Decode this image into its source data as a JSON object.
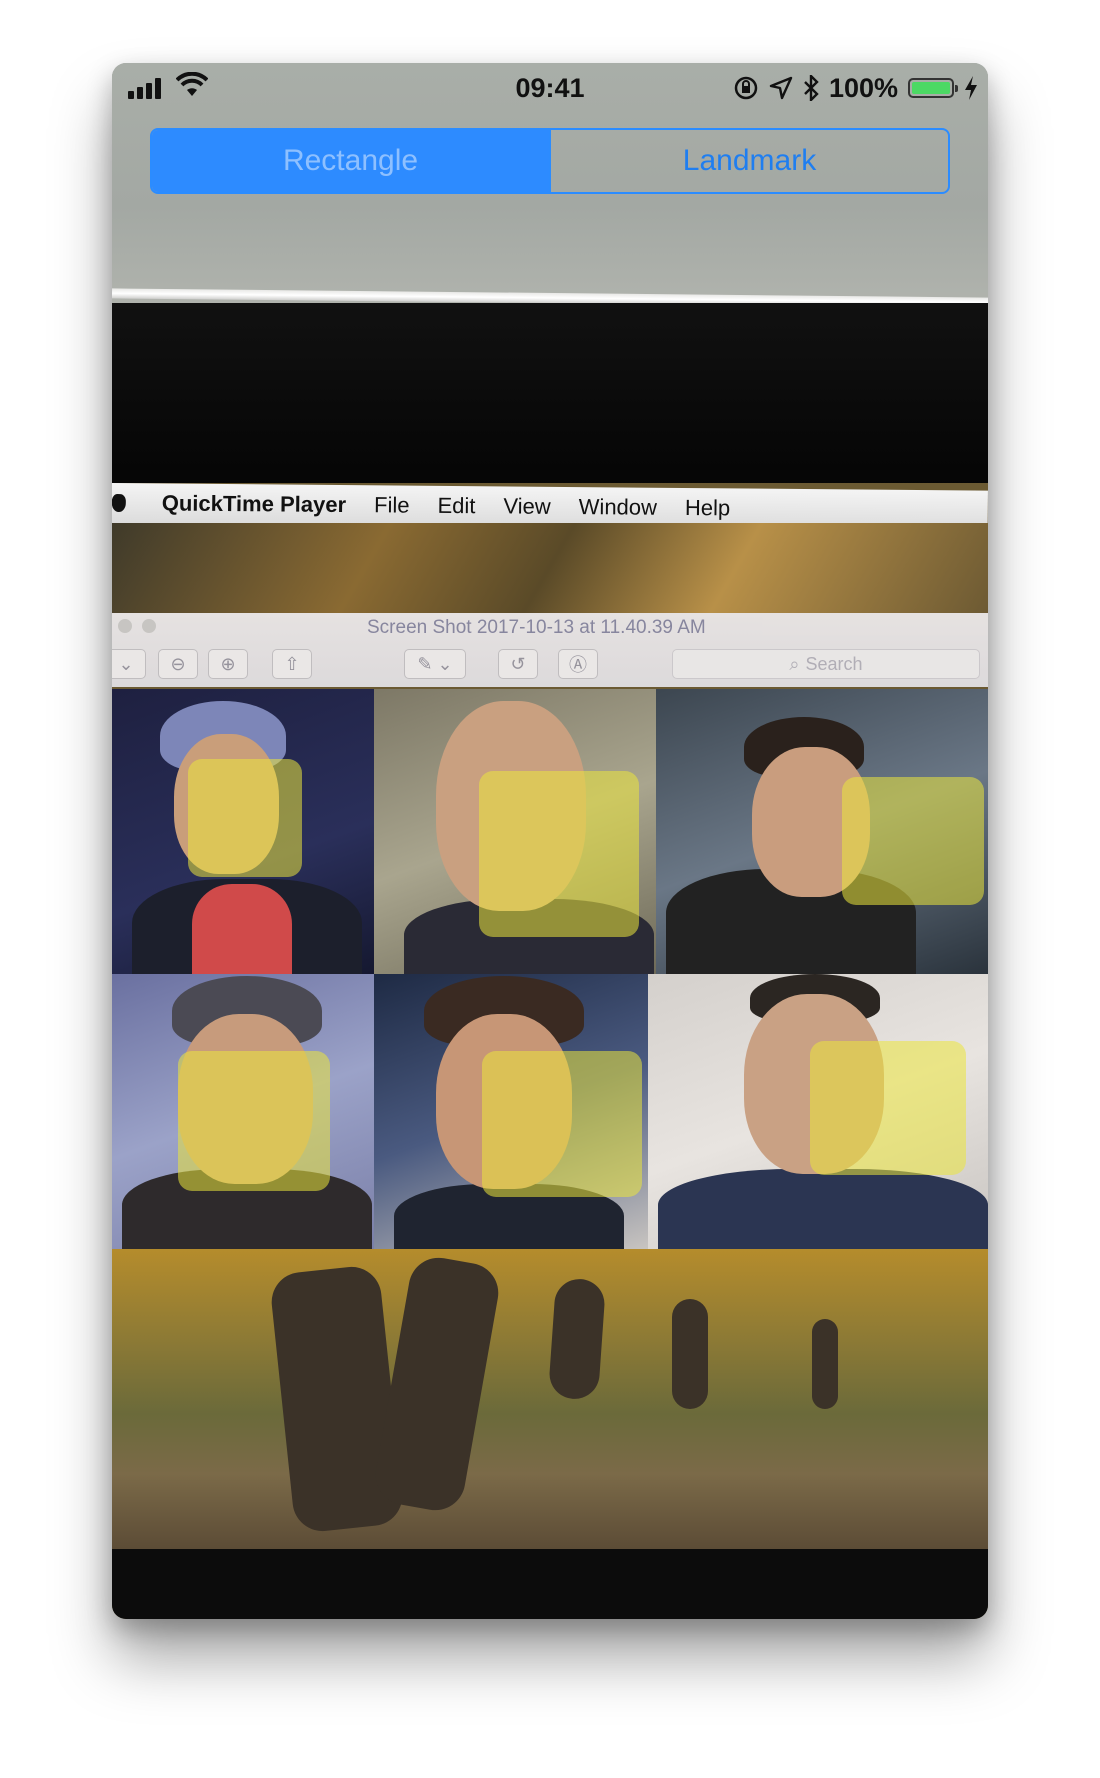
{
  "status_bar": {
    "time": "09:41",
    "battery_percent": "100%",
    "battery_level": 1.0,
    "icons": [
      "cellular-signal-icon",
      "wifi-icon",
      "orientation-lock-icon",
      "location-icon",
      "bluetooth-icon",
      "battery-icon",
      "charging-icon"
    ]
  },
  "segmented_control": {
    "segments": [
      {
        "label": "Rectangle",
        "selected": true
      },
      {
        "label": "Landmark",
        "selected": false
      }
    ],
    "accent_color": "#2d8bff"
  },
  "camera_view": {
    "menubar": {
      "app_name": "QuickTime Player",
      "items": [
        "File",
        "Edit",
        "View",
        "Window",
        "Help"
      ]
    },
    "preview_window": {
      "title": "Screen Shot 2017-10-13 at 11.40.39 AM",
      "search_placeholder": "Search"
    },
    "detection_box_color": "#ebe63c",
    "detected_faces_count": 6
  }
}
